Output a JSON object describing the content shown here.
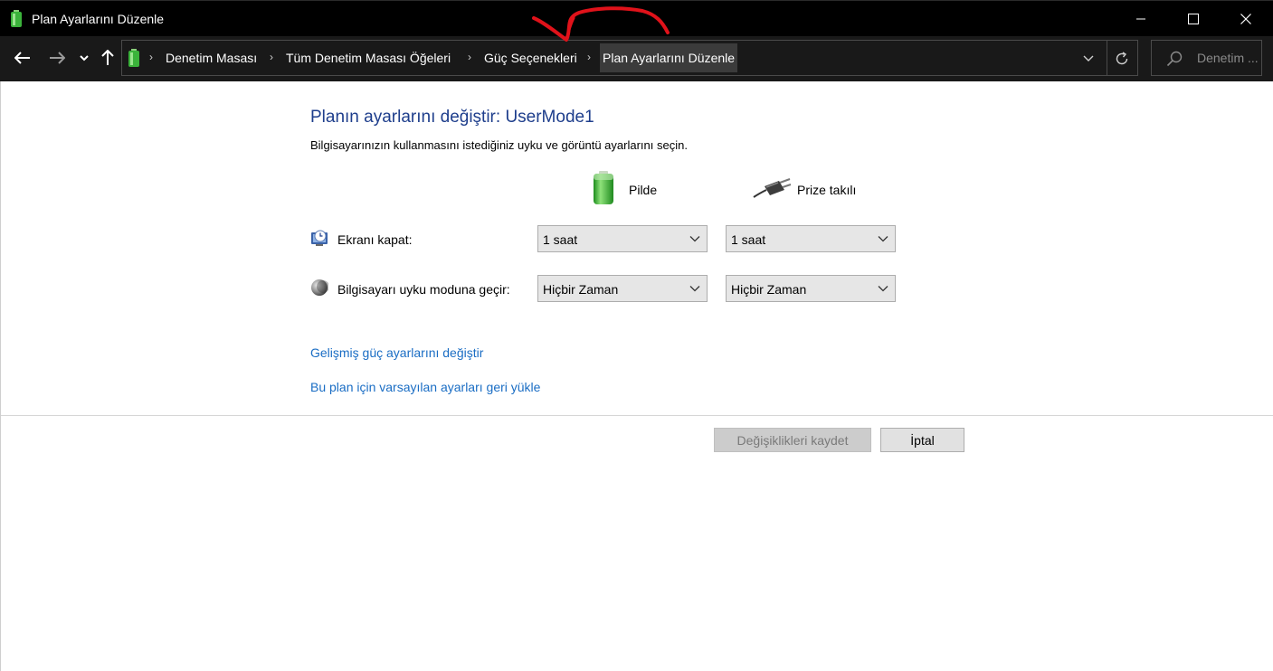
{
  "window": {
    "title": "Plan Ayarlarını Düzenle",
    "icons": {
      "app": "battery-icon",
      "minimize": "minimize-icon",
      "maximize": "maximize-icon",
      "close": "close-icon"
    }
  },
  "navigation": {
    "icons": {
      "back": "arrow-left-icon",
      "forward": "arrow-right-icon",
      "recent": "chevron-down-icon",
      "up": "arrow-up-icon",
      "refresh": "refresh-icon",
      "search": "search-icon"
    },
    "breadcrumbs": [
      "Denetim Masası",
      "Tüm Denetim Masası Öğeleri",
      "Güç Seçenekleri",
      "Plan Ayarlarını Düzenle"
    ],
    "search_placeholder": "Denetim ..."
  },
  "main": {
    "heading": "Planın ayarlarını değiştir: UserMode1",
    "subtitle": "Bilgisayarınızın kullanmasını istediğiniz uyku ve görüntü ayarlarını seçin.",
    "columns": [
      {
        "label": "Pilde",
        "icon": "battery-icon"
      },
      {
        "label": "Prize takılı",
        "icon": "plug-icon"
      }
    ],
    "settings": [
      {
        "label": "Ekranı kapat:",
        "icon": "monitor-clock-icon",
        "on_battery": "1 saat",
        "plugged_in": "1 saat"
      },
      {
        "label": "Bilgisayarı uyku moduna geçir:",
        "icon": "moon-icon",
        "on_battery": "Hiçbir Zaman",
        "plugged_in": "Hiçbir Zaman"
      }
    ],
    "links": {
      "advanced": "Gelişmiş güç ayarlarını değiştir",
      "restore": "Bu plan için varsayılan ayarları geri yükle"
    },
    "buttons": {
      "save": "Değişiklikleri kaydet",
      "cancel": "İptal"
    }
  },
  "colors": {
    "heading": "#1e3e8c",
    "link": "#1a6dc4",
    "titlebar": "#000000",
    "annotation": "#e0121a"
  }
}
